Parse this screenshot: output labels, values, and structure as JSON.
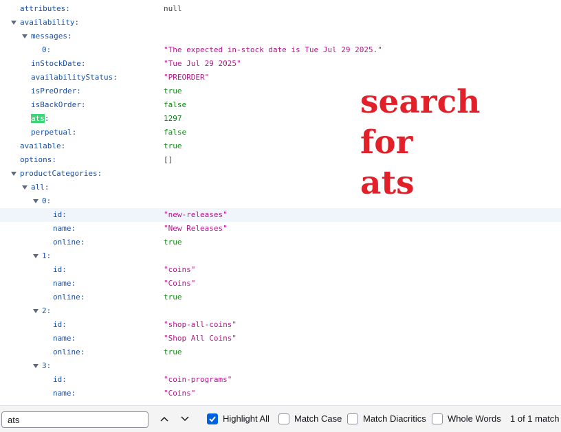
{
  "tree": [
    {
      "key": "attributes:",
      "value": "null",
      "vtype": "null",
      "indent": 0,
      "toggle": false
    },
    {
      "key": "availability:",
      "value": "",
      "vtype": "",
      "indent": 0,
      "toggle": true
    },
    {
      "key": "messages:",
      "value": "",
      "vtype": "",
      "indent": 1,
      "toggle": true
    },
    {
      "key": "0:",
      "value": "\"The expected in-stock date is Tue Jul 29 2025.\"",
      "vtype": "str",
      "indent": 2,
      "toggle": false
    },
    {
      "key": "inStockDate:",
      "value": "\"Tue Jul 29 2025\"",
      "vtype": "str",
      "indent": 1,
      "toggle": false
    },
    {
      "key": "availabilityStatus:",
      "value": "\"PREORDER\"",
      "vtype": "str",
      "indent": 1,
      "toggle": false
    },
    {
      "key": "isPreOrder:",
      "value": "true",
      "vtype": "bool",
      "indent": 1,
      "toggle": false
    },
    {
      "key": "isBackOrder:",
      "value": "false",
      "vtype": "bool",
      "indent": 1,
      "toggle": false
    },
    {
      "key": "ats:",
      "match": "ats",
      "rest": ":",
      "value": "1297",
      "vtype": "num",
      "indent": 1,
      "toggle": false
    },
    {
      "key": "perpetual:",
      "value": "false",
      "vtype": "bool",
      "indent": 1,
      "toggle": false
    },
    {
      "key": "available:",
      "value": "true",
      "vtype": "bool",
      "indent": 0,
      "toggle": false
    },
    {
      "key": "options:",
      "value": "[]",
      "vtype": "arr",
      "indent": 0,
      "toggle": false
    },
    {
      "key": "productCategories:",
      "value": "",
      "vtype": "",
      "indent": 0,
      "toggle": true
    },
    {
      "key": "all:",
      "value": "",
      "vtype": "",
      "indent": 1,
      "toggle": true
    },
    {
      "key": "0:",
      "value": "",
      "vtype": "",
      "indent": 2,
      "toggle": true
    },
    {
      "key": "id:",
      "value": "\"new-releases\"",
      "vtype": "str",
      "indent": 3,
      "toggle": false,
      "selected": true
    },
    {
      "key": "name:",
      "value": "\"New Releases\"",
      "vtype": "str",
      "indent": 3,
      "toggle": false
    },
    {
      "key": "online:",
      "value": "true",
      "vtype": "bool",
      "indent": 3,
      "toggle": false
    },
    {
      "key": "1:",
      "value": "",
      "vtype": "",
      "indent": 2,
      "toggle": true
    },
    {
      "key": "id:",
      "value": "\"coins\"",
      "vtype": "str",
      "indent": 3,
      "toggle": false
    },
    {
      "key": "name:",
      "value": "\"Coins\"",
      "vtype": "str",
      "indent": 3,
      "toggle": false
    },
    {
      "key": "online:",
      "value": "true",
      "vtype": "bool",
      "indent": 3,
      "toggle": false
    },
    {
      "key": "2:",
      "value": "",
      "vtype": "",
      "indent": 2,
      "toggle": true
    },
    {
      "key": "id:",
      "value": "\"shop-all-coins\"",
      "vtype": "str",
      "indent": 3,
      "toggle": false
    },
    {
      "key": "name:",
      "value": "\"Shop All Coins\"",
      "vtype": "str",
      "indent": 3,
      "toggle": false
    },
    {
      "key": "online:",
      "value": "true",
      "vtype": "bool",
      "indent": 3,
      "toggle": false
    },
    {
      "key": "3:",
      "value": "",
      "vtype": "",
      "indent": 2,
      "toggle": true
    },
    {
      "key": "id:",
      "value": "\"coin-programs\"",
      "vtype": "str",
      "indent": 3,
      "toggle": false
    },
    {
      "key": "name:",
      "value": "\"Coins\"",
      "vtype": "str",
      "indent": 3,
      "toggle": false
    }
  ],
  "overlay": {
    "line1": "search",
    "line2": "for",
    "line3": "ats"
  },
  "findbar": {
    "query": "ats",
    "prev_icon": "chevron-up-icon",
    "next_icon": "chevron-down-icon",
    "highlight_all": {
      "label": "Highlight All",
      "checked": true
    },
    "match_case": {
      "label": "Match Case",
      "checked": false
    },
    "match_diacritics": {
      "label": "Match Diacritics",
      "checked": false
    },
    "whole_words": {
      "label": "Whole Words",
      "checked": false
    },
    "match_count": "1 of 1 match"
  },
  "colors": {
    "key": "#1a4fa3",
    "string": "#b0188c",
    "bool": "#0f8a0f",
    "highlight": "#38d878",
    "overlay": "#e2202a",
    "checkbox": "#0061e0"
  }
}
